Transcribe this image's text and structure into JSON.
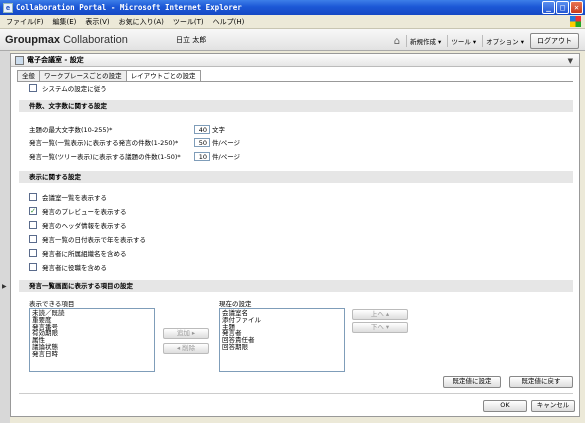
{
  "window": {
    "title": "Collaboration Portal - Microsoft Internet Explorer",
    "min": "_",
    "max": "□",
    "close": "✕"
  },
  "menubar": [
    "ファイル(F)",
    "編集(E)",
    "表示(V)",
    "お気に入り(A)",
    "ツール(T)",
    "ヘルプ(H)"
  ],
  "header": {
    "logo_bold": "Groupmax",
    "logo_rest": "Collaboration",
    "user": "日立 太郎",
    "menus": [
      "新規作成 ▾",
      "ツール ▾",
      "オプション ▾"
    ],
    "logout": "ログアウト"
  },
  "panel": {
    "title": "電子会議室 - 設定"
  },
  "tabs": [
    "全般",
    "ワークプレースごとの設定",
    "レイアウトごとの設定"
  ],
  "system_default": {
    "label": "システムの設定に従う",
    "checked": false
  },
  "sections": {
    "counts": "件数、文字数に関する設定",
    "display": "表示に関する設定",
    "list_items": "発言一覧画面に表示する項目の設定"
  },
  "fields": [
    {
      "label": "主題の最大文字数(10-255)*",
      "value": "40",
      "unit": "文字"
    },
    {
      "label": "発言一覧(一覧表示)に表示する発言の件数(1-250)*",
      "value": "50",
      "unit": "件/ページ"
    },
    {
      "label": "発言一覧(ツリー表示)に表示する議題の件数(1-50)*",
      "value": "10",
      "unit": "件/ページ"
    }
  ],
  "display_options": [
    {
      "label": "会議室一覧を表示する",
      "checked": false
    },
    {
      "label": "発言のプレビューを表示する",
      "checked": true
    },
    {
      "label": "発言のヘッダ情報を表示する",
      "checked": false
    },
    {
      "label": "発言一覧の日付表示で年を表示する",
      "checked": false
    },
    {
      "label": "発言者に所属組織名を含める",
      "checked": false
    },
    {
      "label": "発言者に役職を含める",
      "checked": false
    }
  ],
  "available": {
    "label": "表示できる項目",
    "items": [
      "未読／既読",
      "重要度",
      "発言番号",
      "有効期限",
      "属性",
      "議論状態",
      "発言日時"
    ]
  },
  "current": {
    "label": "現在の設定",
    "items": [
      "会議室名",
      "添付ファイル",
      "主題",
      "発言者",
      "回答責任者",
      "回答期限"
    ]
  },
  "buttons": {
    "add": "追加 ▸",
    "remove": "◂ 削除",
    "up": "上へ ▴",
    "down": "下へ ▾",
    "set_default": "既定値に設定",
    "restore_default": "既定値に戻す",
    "ok": "OK",
    "cancel": "キャンセル"
  }
}
